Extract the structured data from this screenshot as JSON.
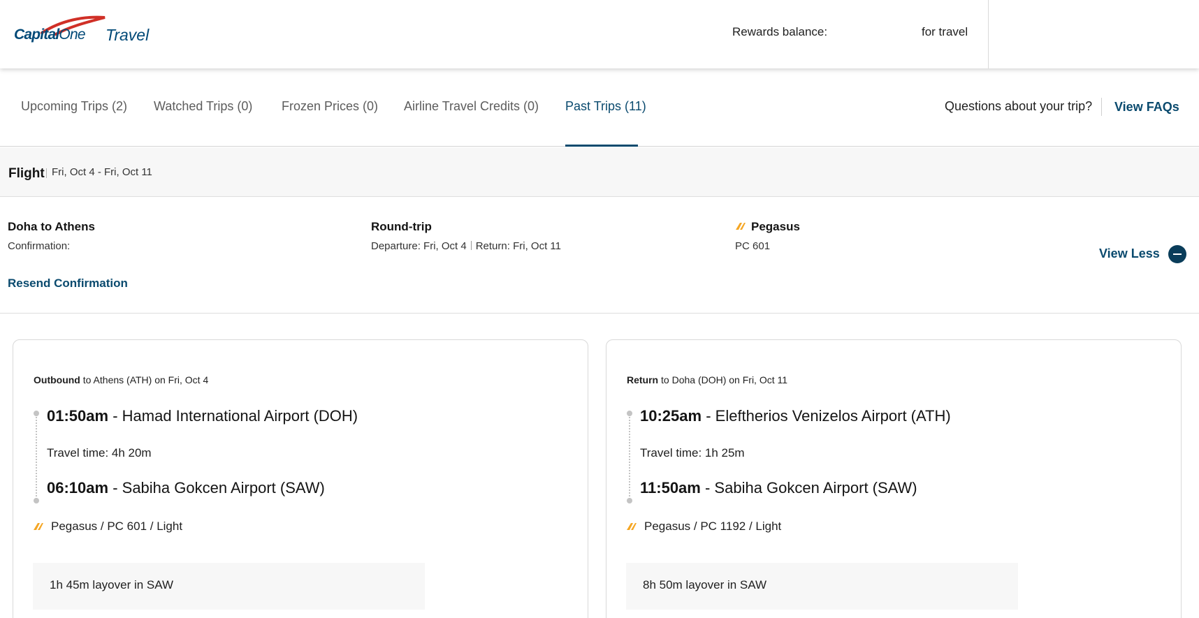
{
  "header": {
    "logo_brand": "Capital One",
    "logo_brand_bold": "Capital",
    "logo_brand_light": "One",
    "logo_product": "Travel",
    "rewards_label": "Rewards balance:",
    "rewards_suffix": "for travel"
  },
  "tabs": [
    {
      "label": "Upcoming Trips (2)",
      "active": false
    },
    {
      "label": "Watched Trips (0)",
      "active": false
    },
    {
      "label": "Frozen Prices (0)",
      "active": false
    },
    {
      "label": "Airline Travel Credits (0)",
      "active": false
    },
    {
      "label": "Past Trips (11)",
      "active": true
    }
  ],
  "faq": {
    "question": "Questions about your trip?",
    "link": "View FAQs"
  },
  "trip": {
    "type": "Flight",
    "dates": "Fri, Oct 4 - Fri, Oct 11"
  },
  "summary": {
    "route": "Doha to Athens",
    "confirmation_label": "Confirmation:",
    "resend": "Resend Confirmation",
    "trip_kind": "Round-trip",
    "departure": "Departure: Fri, Oct 4",
    "return": "Return: Fri, Oct 11",
    "airline": "Pegasus",
    "flight_no": "PC 601",
    "toggle": "View Less"
  },
  "outbound": {
    "direction": "Outbound",
    "rest": "to Athens (ATH) on Fri, Oct 4",
    "dep_time": "01:50am",
    "dep_airport": "Hamad International Airport (DOH)",
    "travel_time": "Travel time: 4h 20m",
    "arr_time": "06:10am",
    "arr_airport": "Sabiha Gokcen Airport (SAW)",
    "carrier": "Pegasus / PC 601 / Light",
    "layover": "1h 45m layover in SAW"
  },
  "return_leg": {
    "direction": "Return",
    "rest": "to Doha (DOH) on Fri, Oct 11",
    "dep_time": "10:25am",
    "dep_airport": "Eleftherios Venizelos Airport (ATH)",
    "travel_time": "Travel time: 1h 25m",
    "arr_time": "11:50am",
    "arr_airport": "Sabiha Gokcen Airport (SAW)",
    "carrier": "Pegasus / PC 1192 / Light",
    "layover": "8h 50m layover in SAW"
  },
  "colors": {
    "brand": "#004977",
    "link": "#0a4a6e",
    "logo_swoosh": "#d03027",
    "airline_icon": "#f5a623"
  }
}
